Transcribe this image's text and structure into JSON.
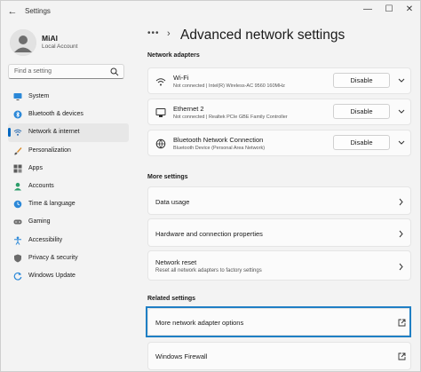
{
  "titlebar": {
    "title": "Settings",
    "min_glyph": "—",
    "max_glyph": "☐",
    "close_glyph": "✕",
    "back_glyph": "←"
  },
  "profile": {
    "name": "MiAl",
    "account": "Local Account"
  },
  "search": {
    "placeholder": "Find a setting"
  },
  "nav": {
    "items": [
      {
        "label": "System",
        "icon": "monitor-icon",
        "active": false
      },
      {
        "label": "Bluetooth & devices",
        "icon": "bluetooth-icon",
        "active": false
      },
      {
        "label": "Network & internet",
        "icon": "wifi-icon",
        "active": true
      },
      {
        "label": "Personalization",
        "icon": "brush-icon",
        "active": false
      },
      {
        "label": "Apps",
        "icon": "apps-icon",
        "active": false
      },
      {
        "label": "Accounts",
        "icon": "person-icon",
        "active": false
      },
      {
        "label": "Time & language",
        "icon": "globe-clock-icon",
        "active": false
      },
      {
        "label": "Gaming",
        "icon": "gamepad-icon",
        "active": false
      },
      {
        "label": "Accessibility",
        "icon": "accessibility-icon",
        "active": false
      },
      {
        "label": "Privacy & security",
        "icon": "shield-icon",
        "active": false
      },
      {
        "label": "Windows Update",
        "icon": "update-icon",
        "active": false
      }
    ]
  },
  "main": {
    "breadcrumb_dots": "•••",
    "breadcrumb_chevron": "›",
    "title": "Advanced network settings",
    "adapters_heading": "Network adapters",
    "adapters": [
      {
        "name": "Wi-Fi",
        "detail": "Not connected | Intel(R) Wireless-AC 9560 160MHz",
        "button": "Disable",
        "icon": "wifi-icon"
      },
      {
        "name": "Ethernet 2",
        "detail": "Not connected | Realtek PCIe GBE Family Controller",
        "button": "Disable",
        "icon": "ethernet-icon"
      },
      {
        "name": "Bluetooth Network Connection",
        "detail": "Bluetooth Device (Personal Area Network)",
        "button": "Disable",
        "icon": "globe-icon"
      }
    ],
    "more_heading": "More settings",
    "more": [
      {
        "title": "Data usage",
        "sub": ""
      },
      {
        "title": "Hardware and connection properties",
        "sub": ""
      },
      {
        "title": "Network reset",
        "sub": "Reset all network adapters to factory settings"
      }
    ],
    "related_heading": "Related settings",
    "related": [
      {
        "title": "More network adapter options"
      },
      {
        "title": "Windows Firewall"
      }
    ]
  },
  "colors": {
    "accent": "#0067c0",
    "highlight_border": "#1f7fc4",
    "background": "#f3f3f3",
    "card": "#fbfbfb"
  }
}
